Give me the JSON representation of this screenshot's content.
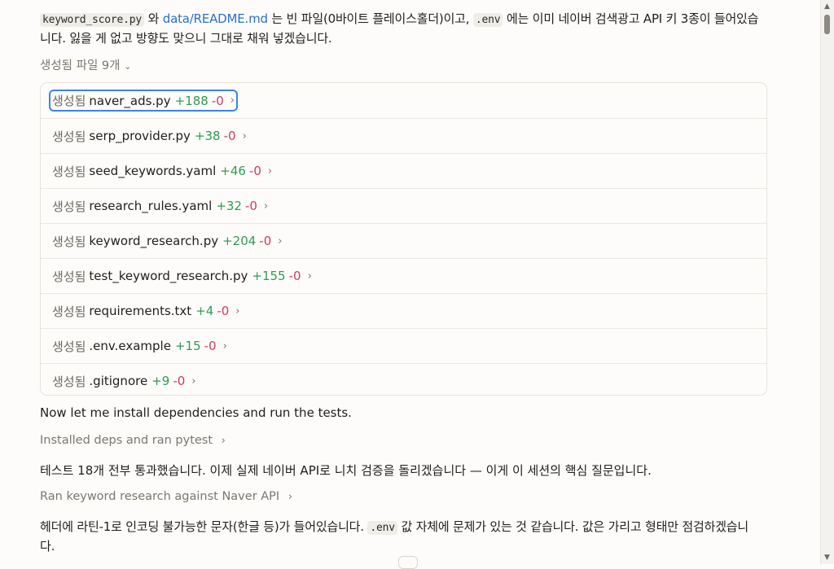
{
  "intro": {
    "code1": "keyword_score.py",
    "t1": " 와 ",
    "link1": "data/README.md",
    "t2": " 는 빈 파일(0바이트 플레이스홀더)이고, ",
    "code2": ".env",
    "t3": " 에는 이미 네이버 검색광고 API 키 3종이 들어있습니다. 잃을 게 없고 방향도 맞으니 그대로 채워 넣겠습니다."
  },
  "files_summary": {
    "label": "생성됨 파일 9개",
    "chevron": "⌄"
  },
  "files": [
    {
      "verb": "생성됨",
      "name": "naver_ads.py",
      "added": "+188",
      "removed": "-0"
    },
    {
      "verb": "생성됨",
      "name": "serp_provider.py",
      "added": "+38",
      "removed": "-0"
    },
    {
      "verb": "생성됨",
      "name": "seed_keywords.yaml",
      "added": "+46",
      "removed": "-0"
    },
    {
      "verb": "생성됨",
      "name": "research_rules.yaml",
      "added": "+32",
      "removed": "-0"
    },
    {
      "verb": "생성됨",
      "name": "keyword_research.py",
      "added": "+204",
      "removed": "-0"
    },
    {
      "verb": "생성됨",
      "name": "test_keyword_research.py",
      "added": "+155",
      "removed": "-0"
    },
    {
      "verb": "생성됨",
      "name": "requirements.txt",
      "added": "+4",
      "removed": "-0"
    },
    {
      "verb": "생성됨",
      "name": ".env.example",
      "added": "+15",
      "removed": "-0"
    },
    {
      "verb": "생성됨",
      "name": ".gitignore",
      "added": "+9",
      "removed": "-0"
    }
  ],
  "chevron_right": "›",
  "messages": {
    "install_note": "Now let me install dependencies and run the tests.",
    "step1": "Installed deps and ran pytest",
    "result1": "테스트 18개 전부 통과했습니다. 이제 실제 네이버 API로 니치 검증을 돌리겠습니다 — 이게 이 세션의 핵심 질문입니다.",
    "step2": "Ran keyword research against Naver API",
    "result2_a": "헤더에 라틴-1로 인코딩 불가능한 문자(한글 등)가 들어있습니다. ",
    "result2_code": ".env",
    "result2_b": " 값 자체에 문제가 있는 것 같습니다. 값은 가리고 형태만 점검하겠습니다."
  },
  "scrollbar": {
    "up": "▲",
    "down": "▼"
  }
}
